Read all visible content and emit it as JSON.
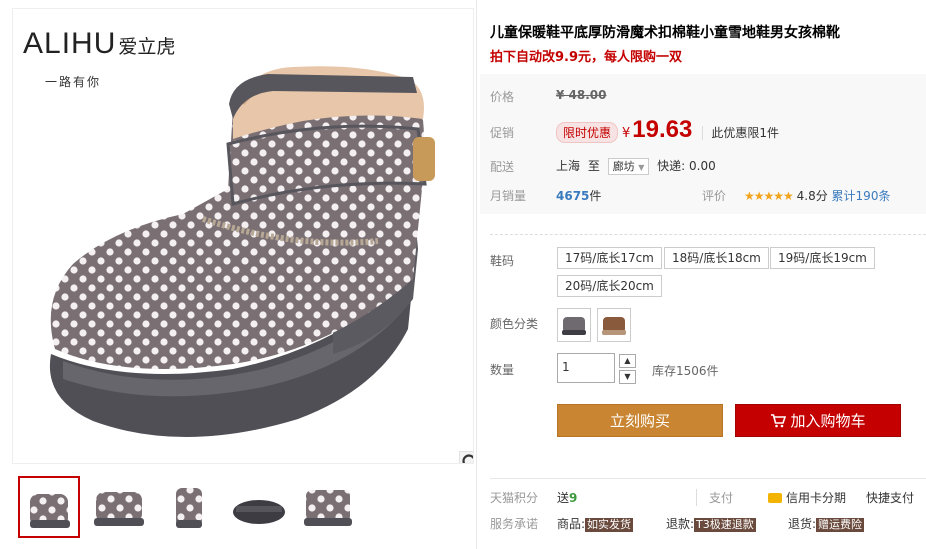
{
  "brand": {
    "name": "ALIHU",
    "cn_name": "爱立虎",
    "slogan": "一路有你"
  },
  "product": {
    "title": "儿童保暖鞋平底厚防滑魔术扣棉鞋小童雪地鞋男女孩棉靴",
    "subtitle": "拍下自动改9.9元，每人限购一双"
  },
  "price": {
    "label": "价格",
    "original": "¥ 48.00",
    "promo_label": "促销",
    "promo_badge": "限时优惠",
    "promo_yen": "¥",
    "promo_value": "19.63",
    "promo_limit": "此优惠限1件",
    "delivery_label": "配送",
    "delivery_from": "上海",
    "delivery_to_word": "至",
    "delivery_region": "廊坊",
    "delivery_fee": "快递: 0.00",
    "sales_label": "月销量",
    "sales_value": "4675",
    "sales_unit": "件",
    "rating_label": "评价",
    "rating_stars": "★★★★★",
    "rating_score": "4.8分",
    "rating_count": "累计190条"
  },
  "sku": {
    "size_label": "鞋码",
    "sizes": [
      "17码/底长17cm",
      "18码/底长18cm",
      "19码/底长19cm",
      "20码/底长20cm"
    ],
    "color_label": "颜色分类",
    "quantity_label": "数量",
    "quantity_value": "1",
    "stock": "库存1506件"
  },
  "actions": {
    "buy_now": "立刻购买",
    "add_to_cart": "加入购物车"
  },
  "services": {
    "points_label": "天猫积分",
    "points_prefix": "送",
    "points_value": "9",
    "pay_label": "支付",
    "credit_installment": "信用卡分期",
    "quick_pay": "快捷支付",
    "promise_label": "服务承诺",
    "goods_prefix": "商品:",
    "goods_tag": "如实发货",
    "refund_prefix": "退款:",
    "refund_tag": "T3极速退款",
    "return_prefix": "退货:",
    "return_tag": "赠运费险"
  },
  "colors": {
    "accent_red": "#c40000",
    "buy_orange": "#c98532",
    "link_blue": "#3a7bbf"
  },
  "icons": [
    "zoom-icon",
    "chevron-up-icon",
    "chevron-down-icon",
    "cart-icon",
    "credit-card-icon",
    "dropdown-arrow-icon",
    "star-icon"
  ]
}
